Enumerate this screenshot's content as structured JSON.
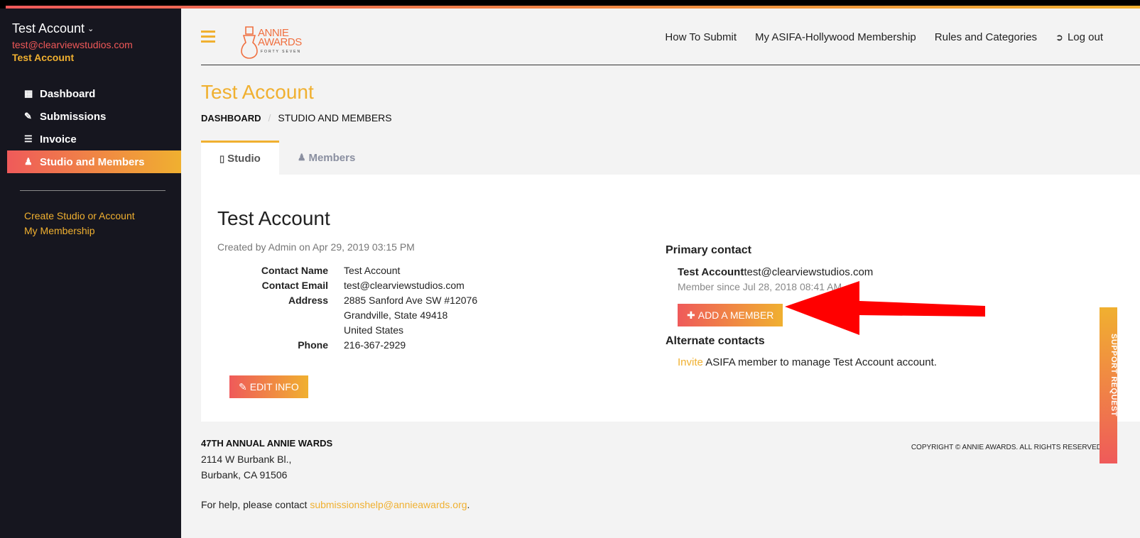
{
  "sidebar": {
    "account_name": "Test Account",
    "account_email": "test@clearviewstudios.com",
    "account_sub": "Test Account",
    "nav": [
      {
        "label": "Dashboard",
        "icon": "dashboard-icon",
        "active": false
      },
      {
        "label": "Submissions",
        "icon": "edit-icon",
        "active": false
      },
      {
        "label": "Invoice",
        "icon": "list-icon",
        "active": false
      },
      {
        "label": "Studio and Members",
        "icon": "user-icon",
        "active": true
      }
    ],
    "links": [
      "Create Studio or Account",
      "My Membership"
    ]
  },
  "header": {
    "logo_line1": "ANNIE",
    "logo_line2": "AWARDS",
    "logo_sub": "FORTY SEVEN",
    "nav": [
      "How To Submit",
      "My ASIFA-Hollywood Membership",
      "Rules and Categories",
      "Log out"
    ]
  },
  "page": {
    "title": "Test Account",
    "breadcrumb": [
      "DASHBOARD",
      "STUDIO AND MEMBERS"
    ],
    "tabs": [
      "Studio",
      "Members"
    ]
  },
  "studio": {
    "name": "Test Account",
    "created": "Created by Admin on Apr 29, 2019 03:15 PM",
    "fields": {
      "contact_name_label": "Contact Name",
      "contact_name": "Test Account",
      "contact_email_label": "Contact Email",
      "contact_email": "test@clearviewstudios.com",
      "address_label": "Address",
      "address_line1": "2885 Sanford Ave SW #12076",
      "address_line2": "Grandville, State 49418",
      "address_line3": "United States",
      "phone_label": "Phone",
      "phone": "216-367-2929"
    },
    "edit_button": "EDIT INFO"
  },
  "contacts": {
    "primary_heading": "Primary contact",
    "primary_name": "Test Account",
    "primary_email": "test@clearviewstudios.com",
    "member_since": "Member since Jul 28, 2018 08:41 AM",
    "add_button": "ADD A MEMBER",
    "alternate_heading": "Alternate contacts",
    "invite_link": "Invite",
    "invite_rest": " ASIFA member to manage Test Account account."
  },
  "support_tab": "SUPPORT REQUEST",
  "footer": {
    "title": "47TH ANNUAL ANNIE WARDS",
    "address_line1": "2114 W Burbank Bl.,",
    "address_line2": "Burbank, CA 91506",
    "copyright": "COPYRIGHT © ANNIE AWARDS. ALL RIGHTS RESERVED",
    "help_prefix": "For help, please contact ",
    "help_email": "submissionshelp@annieawards.org",
    "help_suffix": "."
  },
  "colors": {
    "accent_orange": "#f0b030",
    "accent_red": "#ef5a5a",
    "sidebar_bg": "#16161f",
    "arrow": "#ff0000"
  }
}
